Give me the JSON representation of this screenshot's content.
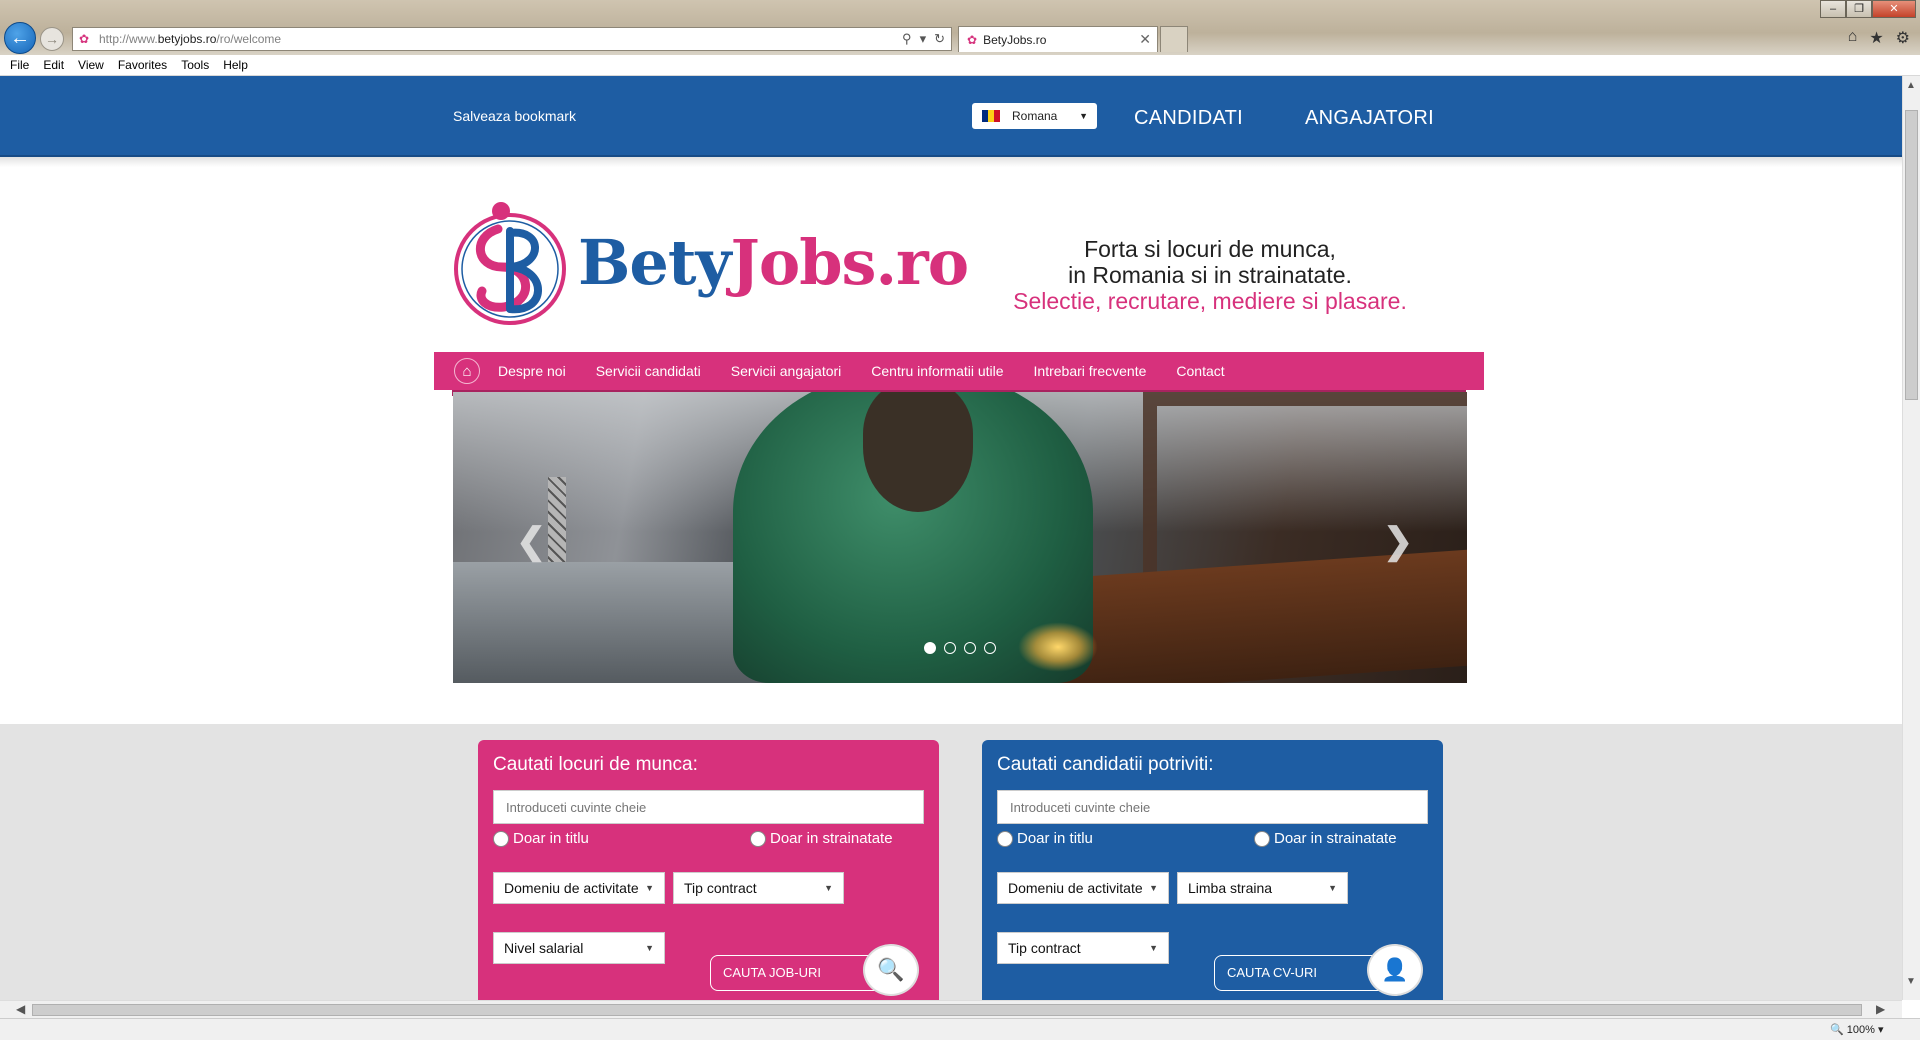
{
  "browser": {
    "url_prefix": "http://www.",
    "url_domain": "betyjobs.ro",
    "url_path": "/ro/welcome",
    "tab_title": "BetyJobs.ro",
    "menu": [
      "File",
      "Edit",
      "View",
      "Favorites",
      "Tools",
      "Help"
    ],
    "zoom": "100%"
  },
  "header": {
    "bookmark_label": "Salveaza bookmark",
    "language": "Romana",
    "nav_candidati": "CANDIDATI",
    "nav_angajatori": "ANGAJATORI"
  },
  "logo": {
    "part1": "Bety",
    "part2": "Jobs.ro"
  },
  "tagline": {
    "line1": "Forta si locuri de munca,",
    "line2": "in Romania si in strainatate.",
    "line3": "Selectie, recrutare, mediere si plasare."
  },
  "main_nav": [
    "Despre noi",
    "Servicii candidati",
    "Servicii angajatori",
    "Centru informatii utile",
    "Intrebari frecvente",
    "Contact"
  ],
  "slider": {
    "slide_count": 4,
    "active_index": 0
  },
  "jobs_panel": {
    "title": "Cautati locuri de munca:",
    "placeholder": "Introduceti cuvinte cheie",
    "radio_left": "Doar in titlu",
    "radio_right": "Doar in strainatate",
    "select1": "Domeniu de activitate",
    "select2": "Tip contract",
    "select3": "Nivel salarial",
    "button": "CAUTA JOB-URI"
  },
  "cand_panel": {
    "title": "Cautati candidatii potriviti:",
    "placeholder": "Introduceti cuvinte cheie",
    "radio_left": "Doar in titlu",
    "radio_right": "Doar in strainatate",
    "select1": "Domeniu de activitate",
    "select2": "Limba straina",
    "select3": "Tip contract",
    "button": "CAUTA CV-URI"
  },
  "colors": {
    "brand_blue": "#1e5da3",
    "brand_pink": "#d7317c"
  }
}
